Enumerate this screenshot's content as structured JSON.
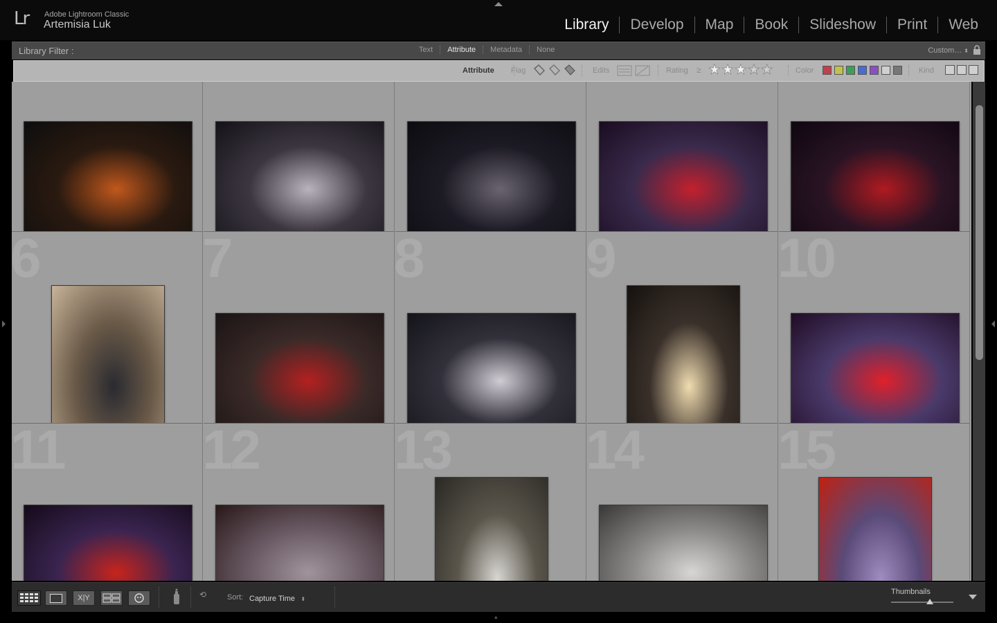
{
  "app": {
    "product": "Adobe Lightroom Classic",
    "user": "Artemisia Luk",
    "logo": "Lr"
  },
  "modules": [
    "Library",
    "Develop",
    "Map",
    "Book",
    "Slideshow",
    "Print",
    "Web"
  ],
  "active_module": "Library",
  "filter": {
    "label": "Library Filter :",
    "tabs": [
      "Text",
      "Attribute",
      "Metadata",
      "None"
    ],
    "active_tab": "Attribute",
    "preset": "Custom…",
    "attribute": {
      "title": "Attribute",
      "flag": "Flag",
      "edits": "Edits",
      "rating": "Rating",
      "rating_op": "≥",
      "rating_stars": 3,
      "color": "Color",
      "kind": "Kind",
      "colors": [
        "#c0404c",
        "#c2c24a",
        "#3f9d5a",
        "#4a6bd0",
        "#8a4fc2",
        "#d0d0d0",
        "#777777"
      ]
    }
  },
  "grid": {
    "cells": [
      {
        "num": "",
        "stars": "★★★",
        "orientation": "landscape",
        "colors": [
          "#2a1a10",
          "#c0581c",
          "#0d0d0d"
        ]
      },
      {
        "num": "",
        "stars": "★★★",
        "orientation": "landscape",
        "colors": [
          "#3c3640",
          "#b9b3be",
          "#141218"
        ]
      },
      {
        "num": "",
        "stars": "★★★",
        "orientation": "landscape",
        "colors": [
          "#1c1a24",
          "#6a6470",
          "#0c0c10"
        ]
      },
      {
        "num": "",
        "stars": "★★★",
        "orientation": "landscape",
        "colors": [
          "#3a2a4c",
          "#c4202c",
          "#1a0c20"
        ]
      },
      {
        "num": "",
        "stars": "★★★",
        "orientation": "landscape",
        "colors": [
          "#2a1424",
          "#b01a20",
          "#0e0610"
        ]
      },
      {
        "num": "6",
        "stars": "★★★",
        "orientation": "portrait",
        "colors": [
          "#6a5a48",
          "#2a2a30",
          "#c8b49a"
        ]
      },
      {
        "num": "7",
        "stars": "★★★",
        "orientation": "landscape",
        "colors": [
          "#3a2a28",
          "#b42020",
          "#1a1414"
        ]
      },
      {
        "num": "8",
        "stars": "★★★",
        "orientation": "landscape",
        "colors": [
          "#32303a",
          "#d0ccd4",
          "#14141a"
        ]
      },
      {
        "num": "9",
        "stars": "★★★",
        "orientation": "portrait",
        "colors": [
          "#3a302a",
          "#f0dcb0",
          "#15110e"
        ]
      },
      {
        "num": "10",
        "stars": "★★★",
        "orientation": "landscape",
        "colors": [
          "#4a3a6a",
          "#e0202a",
          "#200c24"
        ]
      },
      {
        "num": "11",
        "stars": "",
        "orientation": "landscape",
        "colors": [
          "#3a2450",
          "#c8241c",
          "#140a18"
        ]
      },
      {
        "num": "12",
        "stars": "",
        "orientation": "landscape",
        "colors": [
          "#6a5a64",
          "#a0949c",
          "#281818"
        ]
      },
      {
        "num": "13",
        "stars": "",
        "orientation": "portrait",
        "colors": [
          "#5a564c",
          "#d8d6d2",
          "#2a2824"
        ]
      },
      {
        "num": "14",
        "stars": "",
        "orientation": "landscape",
        "colors": [
          "#8c8a88",
          "#d8d6d4",
          "#3a3836"
        ]
      },
      {
        "num": "15",
        "stars": "",
        "orientation": "portrait",
        "colors": [
          "#5a4a78",
          "#a08cc0",
          "#c02010"
        ]
      }
    ]
  },
  "toolbar": {
    "sort_label": "Sort:",
    "sort_value": "Capture Time",
    "thumbnails_label": "Thumbnails",
    "thumbnail_size": 0.62,
    "view_buttons": [
      "grid-view-icon",
      "loupe-view-icon",
      "compare-view-icon",
      "survey-view-icon",
      "people-view-icon"
    ],
    "compare_label": "X|Y"
  }
}
